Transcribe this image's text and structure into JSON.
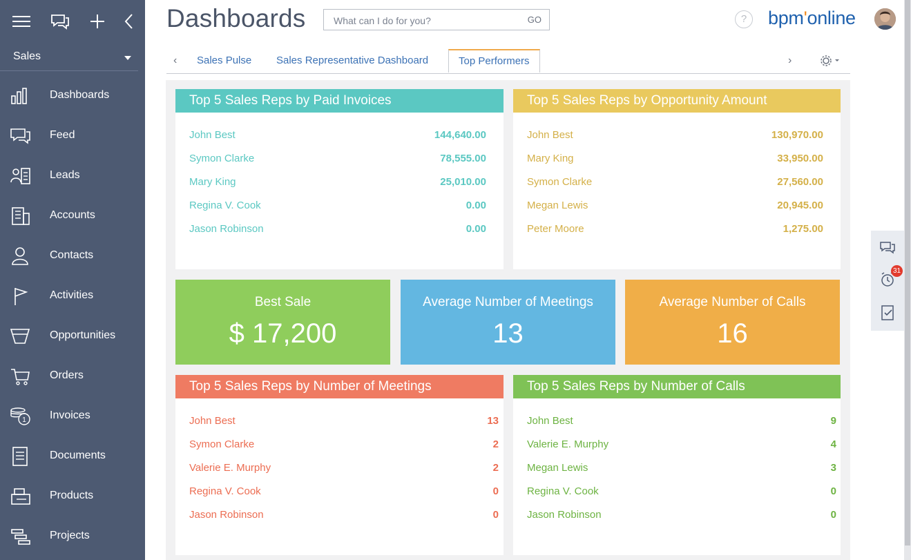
{
  "app": {
    "page_title": "Dashboards",
    "search_placeholder": "What can I do for you?",
    "search_go": "GO",
    "help_label": "?",
    "logo_prefix": "bpm",
    "logo_dot": "'",
    "logo_suffix": "online",
    "notification_count": "31"
  },
  "sidebar": {
    "workspace": "Sales",
    "items": [
      {
        "label": "Dashboards",
        "icon": "bar-chart-icon"
      },
      {
        "label": "Feed",
        "icon": "chat-bubbles-icon"
      },
      {
        "label": "Leads",
        "icon": "lead-icon"
      },
      {
        "label": "Accounts",
        "icon": "building-icon"
      },
      {
        "label": "Contacts",
        "icon": "person-icon"
      },
      {
        "label": "Activities",
        "icon": "flag-icon"
      },
      {
        "label": "Opportunities",
        "icon": "funnel-icon"
      },
      {
        "label": "Orders",
        "icon": "cart-icon"
      },
      {
        "label": "Invoices",
        "icon": "coins-icon"
      },
      {
        "label": "Documents",
        "icon": "document-icon"
      },
      {
        "label": "Products",
        "icon": "products-icon"
      },
      {
        "label": "Projects",
        "icon": "projects-icon"
      }
    ]
  },
  "tabs": [
    {
      "label": "Sales Pulse",
      "active": false
    },
    {
      "label": "Sales Representative Dashboard",
      "active": false
    },
    {
      "label": "Top Performers",
      "active": true
    }
  ],
  "widgets": {
    "paid_invoices": {
      "title": "Top 5 Sales Reps by Paid Invoices",
      "color": "#5bc8c2",
      "rows": [
        {
          "name": "John Best",
          "value": "144,640.00"
        },
        {
          "name": "Symon Clarke",
          "value": "78,555.00"
        },
        {
          "name": "Mary King",
          "value": "25,010.00"
        },
        {
          "name": "Regina V. Cook",
          "value": "0.00"
        },
        {
          "name": "Jason Robinson",
          "value": "0.00"
        }
      ]
    },
    "opportunity_amount": {
      "title": "Top 5 Sales Reps by Opportunity Amount",
      "color": "#e9c95e",
      "rows": [
        {
          "name": "John Best",
          "value": "130,970.00"
        },
        {
          "name": "Mary King",
          "value": "33,950.00"
        },
        {
          "name": "Symon Clarke",
          "value": "27,560.00"
        },
        {
          "name": "Megan Lewis",
          "value": "20,945.00"
        },
        {
          "name": "Peter Moore",
          "value": "1,275.00"
        }
      ]
    },
    "meetings": {
      "title": "Top 5 Sales Reps by Number of Meetings",
      "color": "#ef7b62",
      "rows": [
        {
          "name": "John Best",
          "value": "13"
        },
        {
          "name": "Symon Clarke",
          "value": "2"
        },
        {
          "name": "Valerie E. Murphy",
          "value": "2"
        },
        {
          "name": "Regina V. Cook",
          "value": "0"
        },
        {
          "name": "Jason Robinson",
          "value": "0"
        }
      ]
    },
    "calls": {
      "title": "Top 5 Sales Reps by Number of Calls",
      "color": "#7fc256",
      "rows": [
        {
          "name": "John Best",
          "value": "9"
        },
        {
          "name": "Valerie E. Murphy",
          "value": "4"
        },
        {
          "name": "Megan Lewis",
          "value": "3"
        },
        {
          "name": "Regina V. Cook",
          "value": "0"
        },
        {
          "name": "Jason Robinson",
          "value": "0"
        }
      ]
    }
  },
  "metrics": {
    "best_sale": {
      "title": "Best Sale",
      "value": "$ 17,200",
      "color": "#8fcd5c"
    },
    "avg_meetings": {
      "title": "Average Number of Meetings",
      "value": "13",
      "color": "#63b7e1"
    },
    "avg_calls": {
      "title": "Average Number of Calls",
      "value": "16",
      "color": "#f0ae48"
    }
  }
}
